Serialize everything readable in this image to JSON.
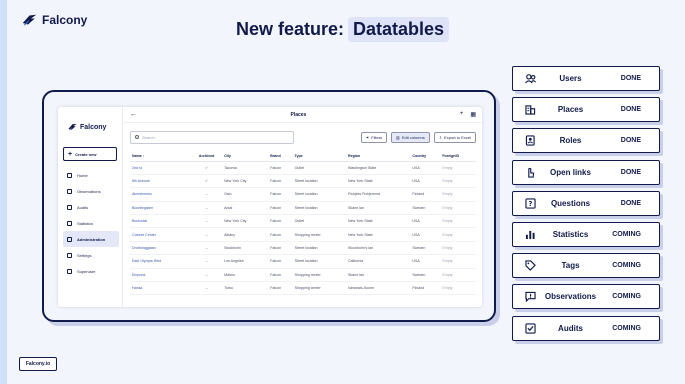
{
  "brand": {
    "name": "Falcony",
    "color": "#111a4a"
  },
  "headline": {
    "prefix": "New feature:",
    "highlight": "Datatables"
  },
  "app": {
    "brand_name": "Falcony",
    "create_label": "Create new",
    "nav": [
      {
        "label": "Home",
        "icon": "home-icon",
        "active": false
      },
      {
        "label": "Observations",
        "icon": "chat-icon",
        "active": false
      },
      {
        "label": "Audits",
        "icon": "checklist-icon",
        "active": false
      },
      {
        "label": "Statistics",
        "icon": "bar-chart-icon",
        "active": false
      },
      {
        "label": "Administration",
        "icon": "people-icon",
        "active": true
      },
      {
        "label": "Settings",
        "icon": "gear-icon",
        "active": false
      },
      {
        "label": "Superuser",
        "icon": "globe-icon",
        "active": false
      }
    ],
    "page_title": "Places",
    "search": {
      "placeholder": "Search",
      "value": ""
    },
    "toolbar": {
      "filters": "Filters",
      "edit_columns": "Edit columns",
      "export": "Export to Excel"
    },
    "table": {
      "columns": [
        "Name ↑",
        "Archived",
        "City",
        "Brand",
        "Type",
        "Region",
        "Country",
        "ForeignID"
      ],
      "rows": [
        [
          "2nd st",
          "✓",
          "Tacoma",
          "Falcon",
          "Outlet",
          "Washington State",
          "USA",
          "Empty"
        ],
        [
          "5th Avenue",
          "✓",
          "New York City",
          "Falcon",
          "Street location",
          "New York State",
          "USA",
          "Empty"
        ],
        [
          "Akershmeks",
          "–",
          "Oslo",
          "Falcon",
          "Street location",
          "Fishjeks Fishjerema",
          "Finland",
          "Empty"
        ],
        [
          "Boorlengsten",
          "–",
          "Arsal",
          "Falcon",
          "Street location",
          "Skane lan",
          "Sweden",
          "Empty"
        ],
        [
          "Bochwick",
          "–",
          "New York City",
          "Falcon",
          "Outlet",
          "New York State",
          "USA",
          "Empty"
        ],
        [
          "Colonie Center",
          "–",
          "Albany",
          "Falcon",
          "Shopping center",
          "New York State",
          "USA",
          "Empty"
        ],
        [
          "Drottninggatan",
          "–",
          "Stockholm",
          "Falcon",
          "Street location",
          "Stockholm's lan",
          "Sweden",
          "Empty"
        ],
        [
          "East Olympic Blvd",
          "–",
          "Los Angeles",
          "Falcon",
          "Street location",
          "California",
          "USA",
          "Empty"
        ],
        [
          "Emporia",
          "–",
          "Malmo",
          "Falcon",
          "Shopping center",
          "Skane lan",
          "Sweden",
          "Empty"
        ],
        [
          "Hansa",
          "–",
          "Turku",
          "Falcon",
          "Shopping center",
          "Varsinais-Suomi",
          "Finland",
          "Empty"
        ]
      ]
    }
  },
  "features": [
    {
      "label": "Users",
      "status": "DONE",
      "icon": "users-icon"
    },
    {
      "label": "Places",
      "status": "DONE",
      "icon": "building-icon"
    },
    {
      "label": "Roles",
      "status": "DONE",
      "icon": "id-badge-icon"
    },
    {
      "label": "Open links",
      "status": "DONE",
      "icon": "hand-pointer-icon"
    },
    {
      "label": "Questions",
      "status": "DONE",
      "icon": "question-icon"
    },
    {
      "label": "Statistics",
      "status": "COMING",
      "icon": "bar-chart-icon"
    },
    {
      "label": "Tags",
      "status": "COMING",
      "icon": "tag-icon"
    },
    {
      "label": "Observations",
      "status": "COMING",
      "icon": "message-alert-icon"
    },
    {
      "label": "Audits",
      "status": "COMING",
      "icon": "checkbox-icon"
    }
  ],
  "footer": {
    "label": "Falcony.io"
  },
  "colors": {
    "navy": "#111a4a",
    "background": "#f3f5fc",
    "shadow": "#c9cfe9",
    "highlight": "#dfe3f8",
    "accent_strip": "#cfe1f7"
  }
}
